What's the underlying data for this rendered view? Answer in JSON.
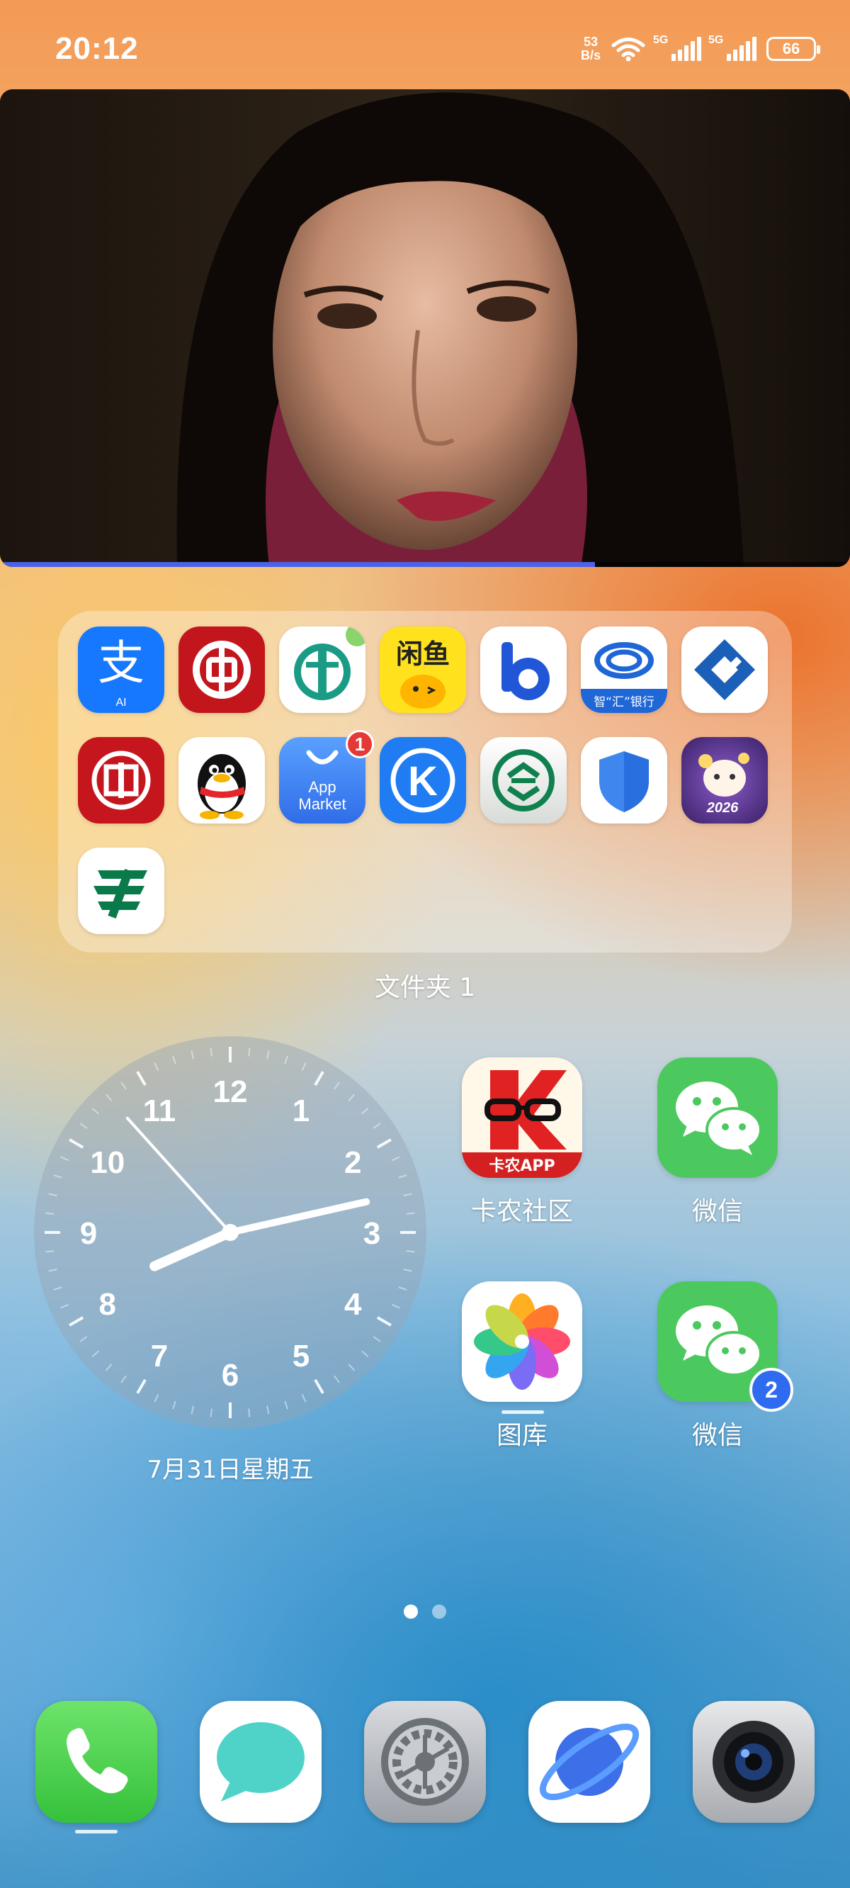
{
  "status_bar": {
    "time": "20:12",
    "speed_value": "53",
    "speed_unit": "B/s",
    "signal_1_label": "5G",
    "signal_2_label": "5G",
    "battery": "66"
  },
  "video_player": {
    "progress_fraction": 0.7
  },
  "folder": {
    "name": "文件夹 1",
    "apps": [
      {
        "name": "支付宝",
        "sub": "AI",
        "icon": "alipay-icon"
      },
      {
        "name": "中国银行",
        "icon": "boc-icon"
      },
      {
        "name": "中国农业银行",
        "icon": "abc-icon"
      },
      {
        "name": "闲鱼",
        "text": "闲鱼",
        "icon": "xianyu-icon"
      },
      {
        "name": "百度",
        "icon": "baidu-icon"
      },
      {
        "name": "智汇银行",
        "text": "智“汇”银行",
        "icon": "bank-spiral-icon"
      },
      {
        "name": "建设银行",
        "icon": "ccb-icon"
      },
      {
        "name": "工商银行",
        "icon": "icbc-icon"
      },
      {
        "name": "QQ",
        "icon": "qq-penguin-icon"
      },
      {
        "name": "App Market",
        "text1": "App",
        "text2": "Market",
        "badge": "1",
        "icon": "app-market-icon"
      },
      {
        "name": "酷狗",
        "text": "K",
        "icon": "kugou-icon"
      },
      {
        "name": "银行",
        "icon": "bank-green-icon"
      },
      {
        "name": "安全",
        "icon": "shield-icon"
      },
      {
        "name": "游戏",
        "icon": "game-mascot-icon"
      },
      {
        "name": "中国邮政",
        "icon": "postal-icon"
      }
    ]
  },
  "clock_widget": {
    "numerals": [
      "12",
      "1",
      "2",
      "3",
      "4",
      "5",
      "6",
      "7",
      "8",
      "9",
      "10",
      "11"
    ],
    "hour": 8,
    "minute": 12,
    "second": 53,
    "date": "7月31日星期五"
  },
  "home_apps": [
    {
      "label": "卡农社区",
      "icon_text": "卡农APP",
      "icon": "kanong-icon"
    },
    {
      "label": "微信",
      "icon": "wechat-icon"
    },
    {
      "label": "图库",
      "icon": "gallery-icon"
    },
    {
      "label": "微信",
      "badge": "2",
      "icon": "wechat-clone-icon"
    }
  ],
  "page_indicator": {
    "count": 2,
    "active": 0
  },
  "dock": [
    {
      "name": "电话",
      "icon": "phone-icon"
    },
    {
      "name": "信息",
      "icon": "messages-icon"
    },
    {
      "name": "设置",
      "icon": "settings-gear-icon"
    },
    {
      "name": "浏览器",
      "icon": "browser-planet-icon"
    },
    {
      "name": "相机",
      "icon": "camera-icon"
    }
  ],
  "colors": {
    "progress": "#4a63e8",
    "wechat_green": "#4cc95e",
    "badge_red": "#e53935",
    "clone_blue": "#2f6bf0"
  }
}
